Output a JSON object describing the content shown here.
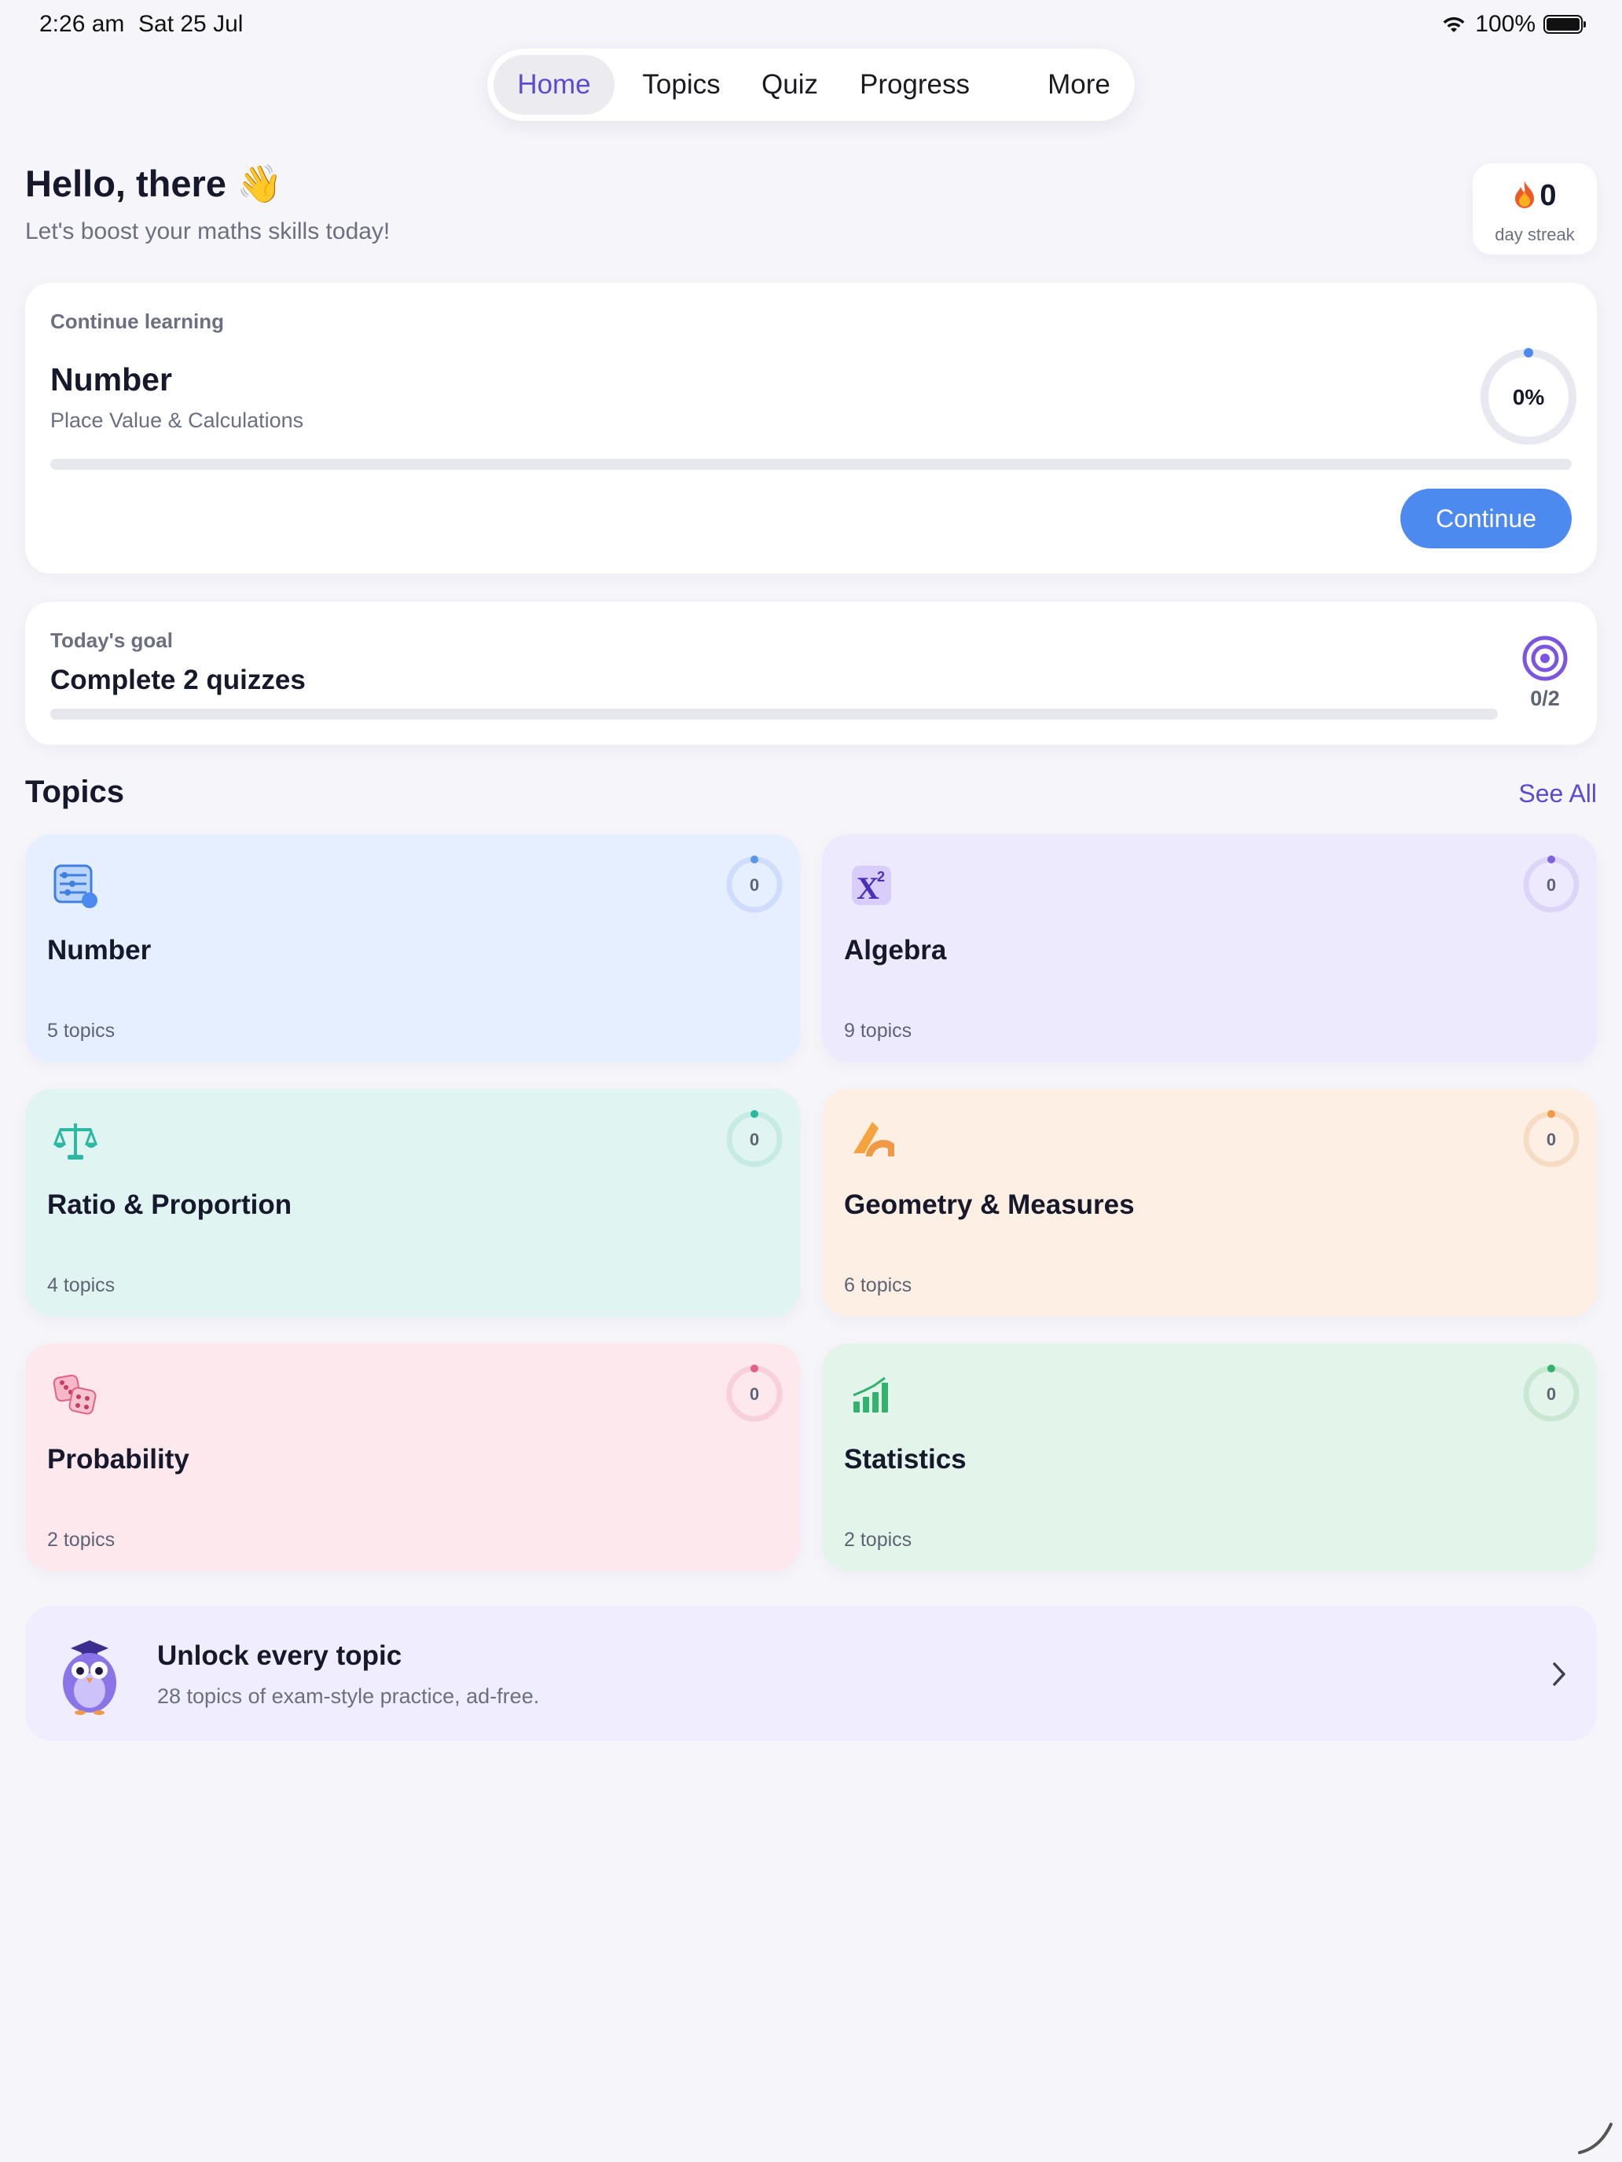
{
  "status_bar": {
    "time": "2:26 am",
    "date": "Sat 25 Jul",
    "battery": "100%"
  },
  "nav": {
    "tabs": [
      {
        "label": "Home",
        "active": true
      },
      {
        "label": "Topics",
        "active": false
      },
      {
        "label": "Quiz",
        "active": false
      },
      {
        "label": "Progress",
        "active": false
      },
      {
        "label": "More",
        "active": false
      }
    ]
  },
  "greeting": {
    "title": "Hello, there",
    "emoji": "👋",
    "subtitle": "Let's boost your maths skills today!"
  },
  "streak": {
    "value": "0",
    "label": "day streak"
  },
  "continue_learning": {
    "label": "Continue learning",
    "title": "Number",
    "subtitle": "Place Value & Calculations",
    "percent": "0%",
    "progress": 0,
    "button": "Continue"
  },
  "goal": {
    "label": "Today's goal",
    "title": "Complete 2 quizzes",
    "count": "0/2",
    "progress": 0
  },
  "topics_section": {
    "title": "Topics",
    "see_all": "See All"
  },
  "topics": [
    {
      "name": "Number",
      "count": "5 topics",
      "progress": "0",
      "icon": "abacus-icon",
      "bg": "#e5efff",
      "accent": "#5a94f0",
      "ring": "#cfdcfb"
    },
    {
      "name": "Algebra",
      "count": "9 topics",
      "progress": "0",
      "icon": "algebra-x-squared-icon",
      "bg": "#eeeafd",
      "accent": "#7c62e0",
      "ring": "#ddd5f8"
    },
    {
      "name": "Ratio & Proportion",
      "count": "4 topics",
      "progress": "0",
      "icon": "balance-scale-icon",
      "bg": "#e0f4f2",
      "accent": "#2bb9a4",
      "ring": "#c5ebe4"
    },
    {
      "name": "Geometry & Measures",
      "count": "6 topics",
      "progress": "0",
      "icon": "protractor-ruler-icon",
      "bg": "#fdefe4",
      "accent": "#f09a46",
      "ring": "#f7dcc4"
    },
    {
      "name": "Probability",
      "count": "2 topics",
      "progress": "0",
      "icon": "dice-icon",
      "bg": "#fde8ee",
      "accent": "#e2608a",
      "ring": "#f7d0dc"
    },
    {
      "name": "Statistics",
      "count": "2 topics",
      "progress": "0",
      "icon": "bar-chart-icon",
      "bg": "#e3f4ea",
      "accent": "#32b26c",
      "ring": "#c8e8d4"
    }
  ],
  "promo": {
    "title": "Unlock every topic",
    "subtitle": "28 topics of exam-style practice, ad-free.",
    "icon": "owl-mascot-icon"
  },
  "colors": {
    "accent": "#5b4bd1",
    "primary_button": "#4d8af0",
    "background": "#f5f5fa"
  }
}
